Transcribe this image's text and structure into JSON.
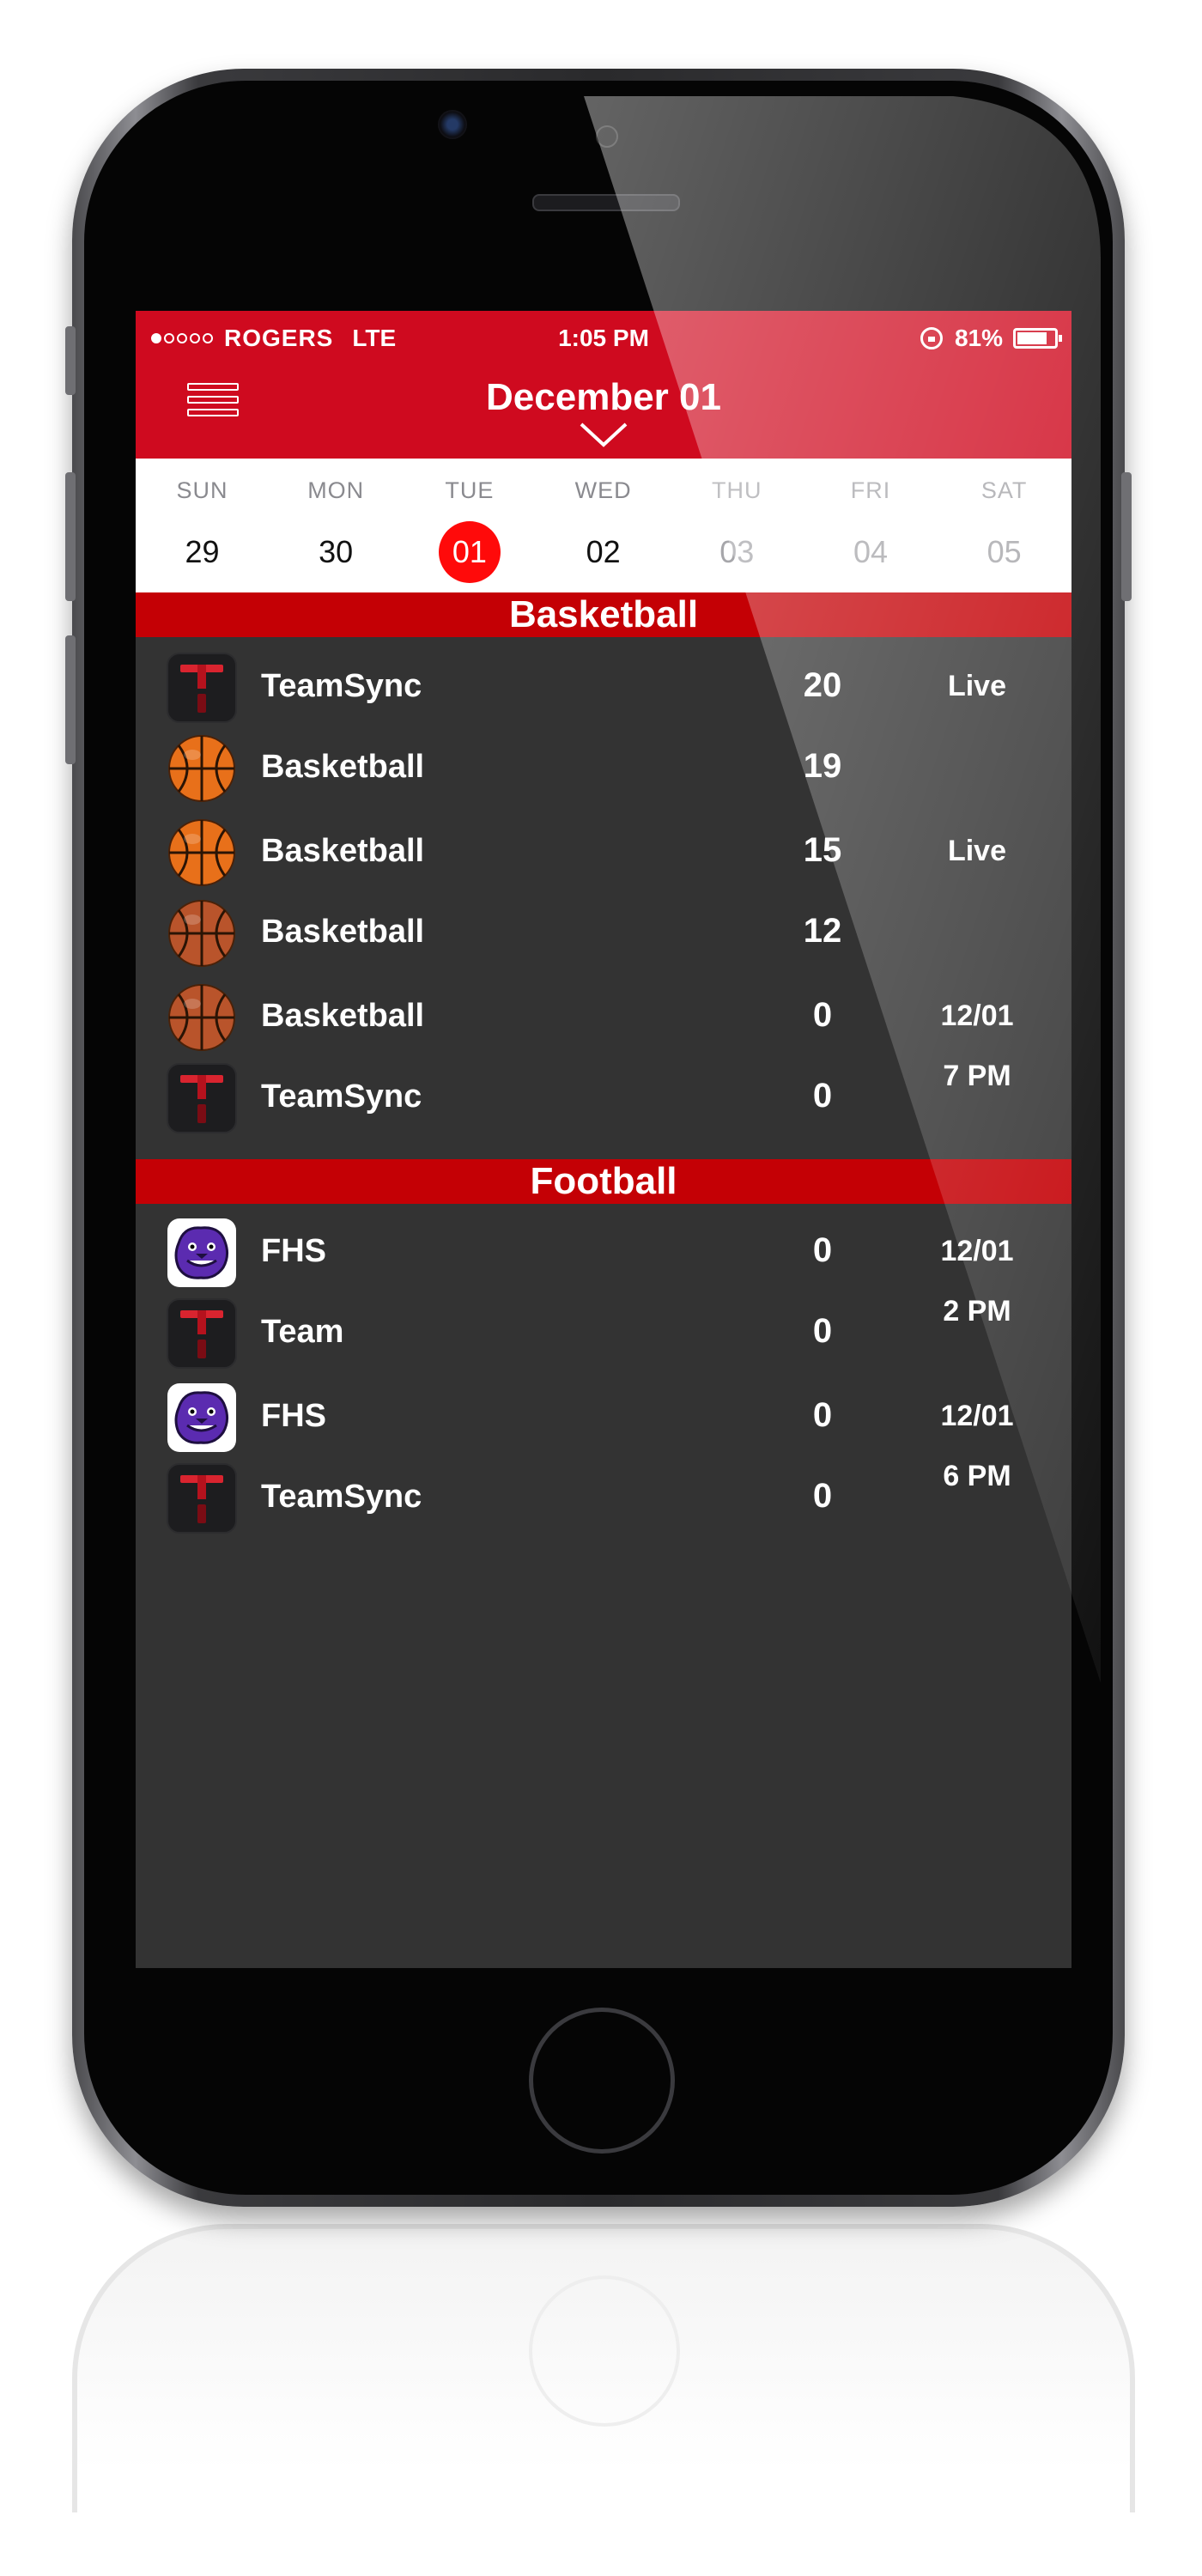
{
  "status_bar": {
    "carrier": "ROGERS",
    "network": "LTE",
    "time": "1:05 PM",
    "battery_percent": "81%",
    "battery_level": 0.81,
    "signal_bars_filled": 1,
    "signal_bars_total": 5
  },
  "header": {
    "title": "December 01",
    "menu_icon": "hamburger-menu-icon",
    "expand_icon": "chevron-down-icon"
  },
  "week": [
    {
      "name": "SUN",
      "num": "29",
      "state": "past"
    },
    {
      "name": "MON",
      "num": "30",
      "state": "past"
    },
    {
      "name": "TUE",
      "num": "01",
      "state": "selected"
    },
    {
      "name": "WED",
      "num": "02",
      "state": "past"
    },
    {
      "name": "THU",
      "num": "03",
      "state": "future"
    },
    {
      "name": "FRI",
      "num": "04",
      "state": "future"
    },
    {
      "name": "SAT",
      "num": "05",
      "state": "future"
    }
  ],
  "sections": [
    {
      "title": "Basketball",
      "games": [
        {
          "teams": [
            {
              "name": "TeamSync",
              "score": "20",
              "logo": "teamsync"
            },
            {
              "name": "Basketball",
              "score": "19",
              "logo": "basketball"
            }
          ],
          "status": [
            "Live",
            ""
          ]
        },
        {
          "teams": [
            {
              "name": "Basketball",
              "score": "15",
              "logo": "basketball"
            },
            {
              "name": "Basketball",
              "score": "12",
              "logo": "basketball-dark"
            }
          ],
          "status": [
            "Live",
            ""
          ]
        },
        {
          "teams": [
            {
              "name": "Basketball",
              "score": "0",
              "logo": "basketball-dark"
            },
            {
              "name": "TeamSync",
              "score": "0",
              "logo": "teamsync"
            }
          ],
          "status": [
            "12/01",
            "7 PM"
          ]
        }
      ]
    },
    {
      "title": "Football",
      "games": [
        {
          "teams": [
            {
              "name": "FHS",
              "score": "0",
              "logo": "fhs-bulldog"
            },
            {
              "name": "Team",
              "score": "0",
              "logo": "teamsync"
            }
          ],
          "status": [
            "12/01",
            "2 PM"
          ]
        },
        {
          "teams": [
            {
              "name": "FHS",
              "score": "0",
              "logo": "fhs-bulldog"
            },
            {
              "name": "TeamSync",
              "score": "0",
              "logo": "teamsync"
            }
          ],
          "status": [
            "12/01",
            "6 PM"
          ]
        }
      ]
    }
  ],
  "colors": {
    "header_red": "#cf0a1f",
    "section_red": "#c40005",
    "selected_day": "#ff0a0a",
    "list_background": "#333333"
  }
}
